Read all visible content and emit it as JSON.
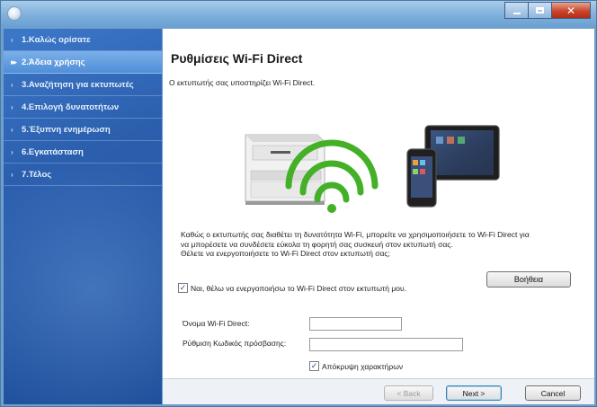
{
  "window": {
    "title": ""
  },
  "sidebar": {
    "items": [
      {
        "label": "1.Καλώς ορίσατε",
        "active": false
      },
      {
        "label": "2.Άδεια χρήσης",
        "active": true
      },
      {
        "label": "3.Αναζήτηση για εκτυπωτές",
        "active": false
      },
      {
        "label": "4.Επιλογή δυνατοτήτων",
        "active": false
      },
      {
        "label": "5.Έξυπνη ενημέρωση",
        "active": false
      },
      {
        "label": "6.Εγκατάσταση",
        "active": false
      },
      {
        "label": "7.Τέλος",
        "active": false
      }
    ]
  },
  "main": {
    "title": "Ρυθμίσεις Wi-Fi Direct",
    "subtitle": "Ο εκτυπωτής σας υποστηρίζει Wi-Fi Direct.",
    "illustration_icons": [
      "printer-icon",
      "wifi-icon",
      "smartphone-icon",
      "tablet-icon"
    ],
    "desc_line1": "Καθώς ο εκτυπωτής σας διαθέτει τη δυνατότητα Wi-Fi, μπορείτε να χρησιμοποιήσετε το Wi-Fi Direct για",
    "desc_line2": "να μπορέσετε να συνδέσετε εύκολα τη φορητή σας συσκευή στον εκτυπωτή σας.",
    "desc_line3": "Θέλετε να ενεργοποιήσετε το Wi-Fi Direct στον εκτυπωτή σας;",
    "help_label": "Βοήθεια",
    "enable_checkbox": {
      "label": "Ναι, θέλω να ενεργοποιήσω το Wi-Fi Direct στον εκτυπωτή μου.",
      "checked": true
    },
    "name_label": "Όνομα Wi-Fi Direct:",
    "name_value": "",
    "password_label": "Ρύθμιση Κωδικός πρόσβασης:",
    "password_value": "",
    "hide_checkbox": {
      "label": "Απόκρυψη χαρακτήρων",
      "checked": true
    }
  },
  "footer": {
    "back_label": "< Back",
    "next_label": "Next >",
    "cancel_label": "Cancel"
  },
  "colors": {
    "sidebar": "#2b5fae",
    "sidebar_active": "#5b98dc",
    "wifi_green": "#44b028",
    "titlebar": "#7fb0dc",
    "close_button": "#c8452c"
  }
}
